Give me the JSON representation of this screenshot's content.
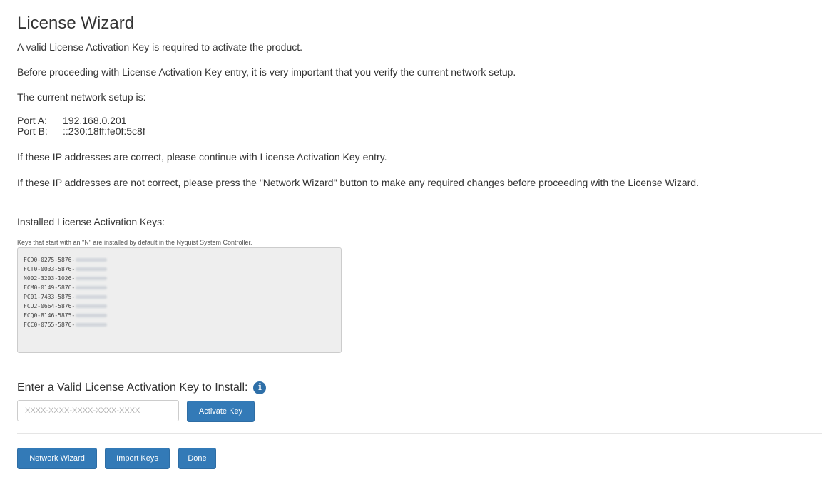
{
  "page": {
    "title": "License Wizard",
    "intro": "A valid License Activation Key is required to activate the product.",
    "verify": "Before proceeding with License Activation Key entry, it is very important that you verify the current network setup.",
    "setup_label": "The current network setup is:",
    "ports": [
      {
        "label": "Port A:",
        "value": "192.168.0.201"
      },
      {
        "label": "Port B:",
        "value": "::230:18ff:fe0f:5c8f"
      }
    ],
    "correct_msg": "If these IP addresses are correct, please continue with License Activation Key entry.",
    "incorrect_msg": "If these IP addresses are not correct, please press the \"Network Wizard\" button to make any required changes before proceeding with the License Wizard."
  },
  "installed": {
    "heading": "Installed License Activation Keys:",
    "note": "Keys that start with an \"N\" are installed by default in the Nyquist System Controller.",
    "keys": [
      "FCD0-0275-5876-",
      "FCT0-0033-5876-",
      "N002-3203-1026-",
      "FCM0-0149-5876-",
      "PC01-7433-5875-",
      "FCU2-0664-5876-",
      "FCQ0-8146-5875-",
      "FCC0-0755-5876-"
    ]
  },
  "entry": {
    "label": "Enter a Valid License Activation Key to Install:",
    "placeholder": "XXXX-XXXX-XXXX-XXXX-XXXX",
    "value": "",
    "activate_label": "Activate Key",
    "info_icon": "info-circle-icon"
  },
  "footer": {
    "network_label": "Network Wizard",
    "import_label": "Import Keys",
    "done_label": "Done"
  },
  "colors": {
    "primary_button": "#337ab7",
    "info_icon": "#2e6fa8"
  }
}
